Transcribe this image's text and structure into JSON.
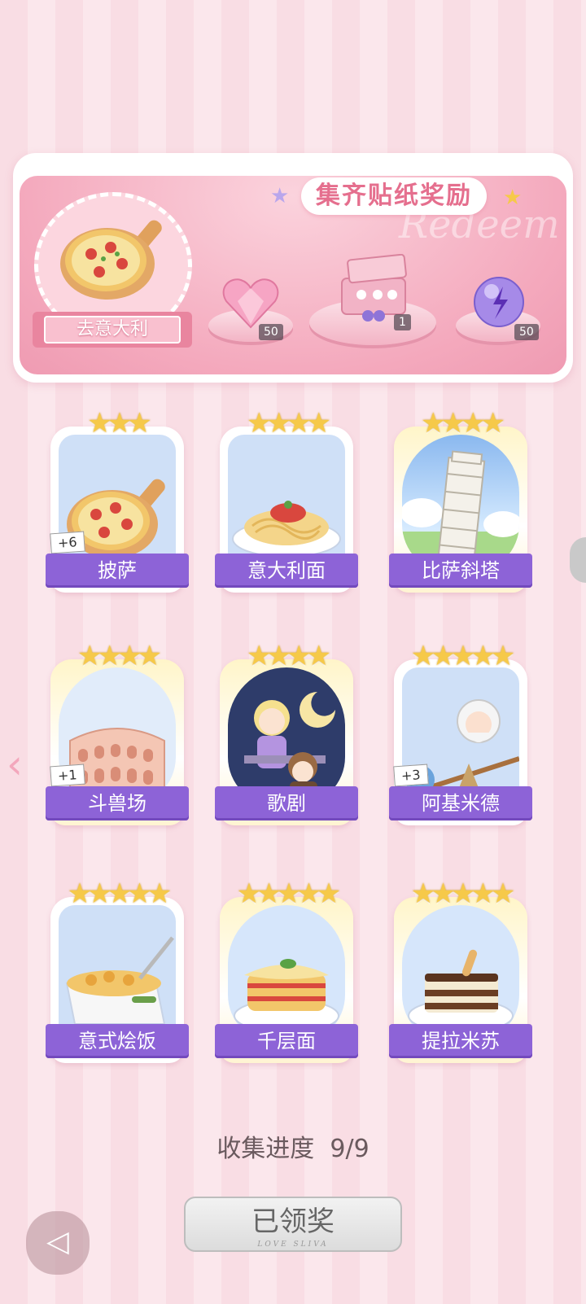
{
  "banner": {
    "title": "集齐贴纸奖励",
    "ghost_text": "Redeem",
    "theme_label": "去意大利",
    "rewards": [
      {
        "icon": "pink-heart-gem-icon",
        "count": "50"
      },
      {
        "icon": "gift-box-icon",
        "count": "1"
      },
      {
        "icon": "purple-energy-orb-icon",
        "count": "50"
      }
    ]
  },
  "cards": [
    {
      "label": "披萨",
      "stars": 3,
      "badge": "+6",
      "icon": "pizza-icon"
    },
    {
      "label": "意大利面",
      "stars": 4,
      "badge": "",
      "icon": "spaghetti-icon"
    },
    {
      "label": "比萨斜塔",
      "stars": 4,
      "badge": "",
      "icon": "leaning-tower-icon"
    },
    {
      "label": "斗兽场",
      "stars": 4,
      "badge": "+1",
      "icon": "colosseum-icon"
    },
    {
      "label": "歌剧",
      "stars": 4,
      "badge": "",
      "icon": "opera-icon"
    },
    {
      "label": "阿基米德",
      "stars": 5,
      "badge": "+3",
      "icon": "archimedes-icon"
    },
    {
      "label": "意式烩饭",
      "stars": 5,
      "badge": "",
      "icon": "risotto-icon"
    },
    {
      "label": "千层面",
      "stars": 5,
      "badge": "",
      "icon": "lasagna-icon"
    },
    {
      "label": "提拉米苏",
      "stars": 5,
      "badge": "",
      "icon": "tiramisu-icon"
    }
  ],
  "progress": {
    "label": "收集进度",
    "value": "9/9"
  },
  "claim_button": {
    "label": "已领奖",
    "subtitle": "LOVE SLIVA"
  },
  "colors": {
    "accent_purple": "#8d63d7",
    "accent_pink": "#e56f8e",
    "star": "#f6c949"
  }
}
